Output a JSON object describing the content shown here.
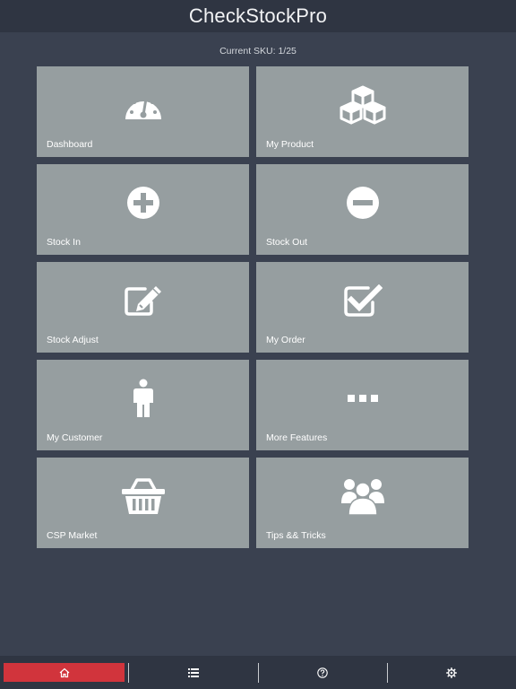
{
  "app": {
    "title": "CheckStockPro"
  },
  "status": {
    "current_sku": "Current SKU: 1/25"
  },
  "tiles": [
    {
      "label": "Dashboard",
      "icon": "dashboard-gauge-icon"
    },
    {
      "label": "My Product",
      "icon": "boxes-icon"
    },
    {
      "label": "Stock In",
      "icon": "plus-circle-icon"
    },
    {
      "label": "Stock Out",
      "icon": "minus-circle-icon"
    },
    {
      "label": "Stock Adjust",
      "icon": "edit-icon"
    },
    {
      "label": "My Order",
      "icon": "checkbox-icon"
    },
    {
      "label": "My Customer",
      "icon": "person-icon"
    },
    {
      "label": "More Features",
      "icon": "ellipsis-icon"
    },
    {
      "label": "CSP Market",
      "icon": "basket-icon"
    },
    {
      "label": "Tips && Tricks",
      "icon": "group-icon"
    }
  ],
  "tabbar": {
    "active_color": "#d1343c",
    "tabs": [
      {
        "icon": "home-icon",
        "active": true
      },
      {
        "icon": "list-icon",
        "active": false
      },
      {
        "icon": "help-icon",
        "active": false
      },
      {
        "icon": "gear-icon",
        "active": false
      }
    ]
  },
  "colors": {
    "background": "#3a4150",
    "header": "#2f3542",
    "tile": "#969ea0"
  }
}
